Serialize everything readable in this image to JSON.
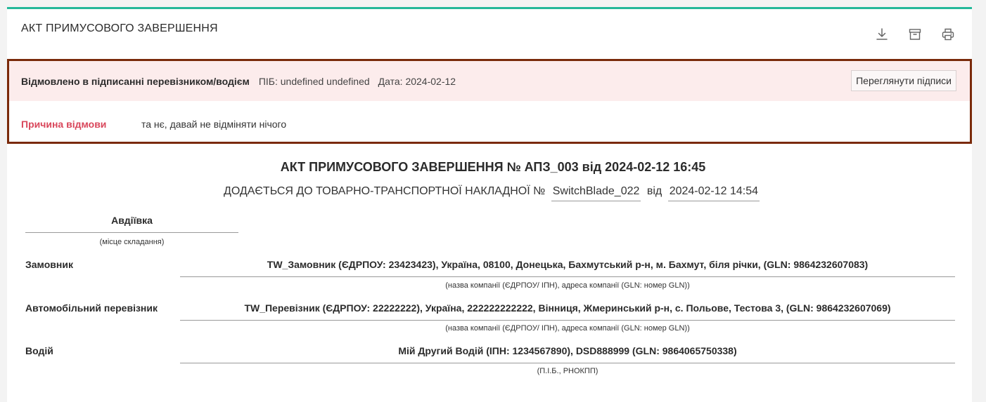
{
  "header": {
    "title": "АКТ ПРИМУСОВОГО ЗАВЕРШЕННЯ"
  },
  "toolbar": {
    "icons": [
      "download-icon",
      "archive-icon",
      "print-icon"
    ]
  },
  "rejection": {
    "status": "Відмовлено в підписанні перевізником/водієм",
    "person": "ПІБ: undefined undefined",
    "date": "Дата: 2024-02-12",
    "view_signatures_label": "Переглянути підписи",
    "reason_label": "Причина відмови",
    "reason_text": "та нє, давай не відміняти нічого"
  },
  "document": {
    "title": "АКТ ПРИМУСОВОГО ЗАВЕРШЕННЯ № АПЗ_003 від 2024-02-12 16:45",
    "subtitle_prefix": "ДОДАЄТЬСЯ ДО ТОВАРНО-ТРАНСПОРТНОЇ НАКЛАДНОЇ №",
    "waybill_number": "SwitchBlade_022",
    "subtitle_from": "від",
    "waybill_date": "2024-02-12 14:54",
    "place": "Авдіївка",
    "place_hint": "(місце складання)",
    "customer_label": "Замовник",
    "customer_value": "TW_Замовник (ЄДРПОУ: 23423423), Україна, 08100, Донецька, Бахмутський р-н, м. Бахмут, біля річки, (GLN: 9864232607083)",
    "customer_hint": "(назва компанії (ЄДРПОУ/ ІПН), адреса компанії (GLN: номер GLN))",
    "carrier_label": "Автомобільний перевізник",
    "carrier_value": "TW_Перевізник (ЄДРПОУ: 22222222), Україна, 222222222222, Вінниця, Жмеринський р-н, с. Польове, Тестова 3, (GLN: 9864232607069)",
    "carrier_hint": "(назва компанії (ЄДРПОУ/ ІПН), адреса компанії (GLN: номер GLN))",
    "driver_label": "Водій",
    "driver_value": "Мій Другий Водій (ІПН: 1234567890), DSD888999 (GLN: 9864065750338)",
    "driver_hint": "(П.І.Б., РНОКПП)"
  }
}
